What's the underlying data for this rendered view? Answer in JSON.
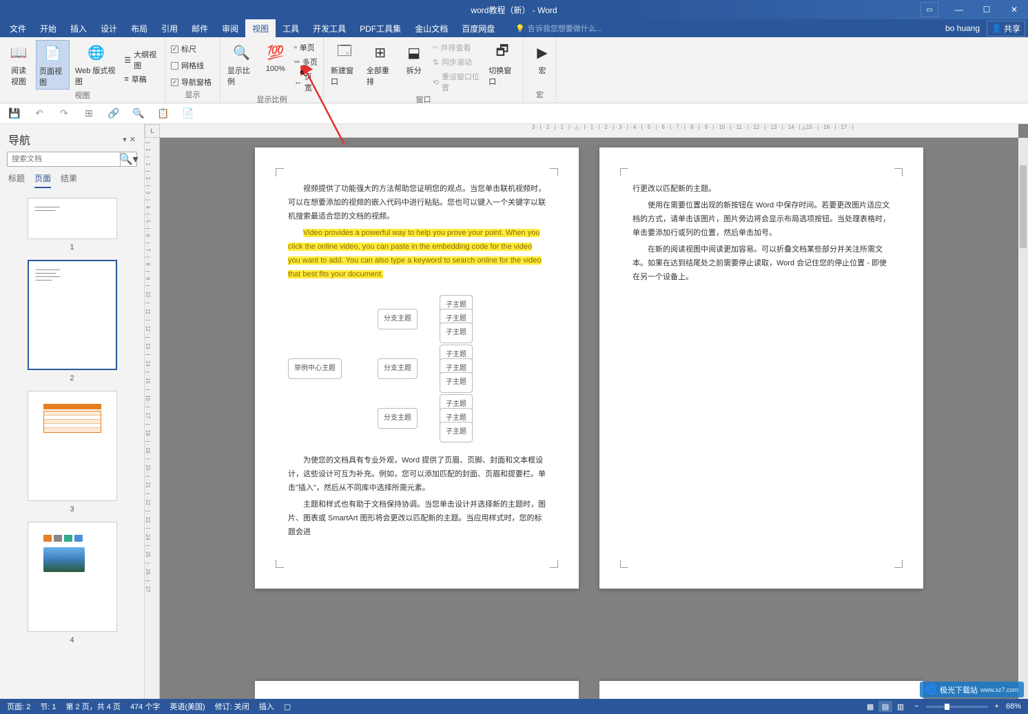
{
  "title": "word教程（新） - Word",
  "username": "bo huang",
  "share": "共享",
  "menu": [
    "文件",
    "开始",
    "插入",
    "设计",
    "布局",
    "引用",
    "邮件",
    "审阅",
    "视图",
    "工具",
    "开发工具",
    "PDF工具集",
    "金山文档",
    "百度网盘"
  ],
  "menu_active": "视图",
  "tellme": "告诉我您想要做什么...",
  "ribbon": {
    "views_group": {
      "read": "阅读\n视图",
      "page": "页面视图",
      "web": "Web 版式视图",
      "outline": "大纲视图",
      "draft": "草稿",
      "label": "视图"
    },
    "show_group": {
      "ruler": "标尺",
      "gridlines": "网格线",
      "navpane": "导航窗格",
      "label": "显示"
    },
    "zoom_group": {
      "showzoom": "显示比例",
      "hundred": "100%",
      "single": "单页",
      "multi": "多页",
      "pagewidth": "页宽",
      "label": "显示比例"
    },
    "window_group": {
      "newwin": "新建窗口",
      "arrange": "全部重排",
      "split": "拆分",
      "sidebyside": "并排查看",
      "syncscroll": "同步滚动",
      "resetpos": "重设窗口位置",
      "switch": "切换窗口",
      "label": "窗口"
    },
    "macro_group": {
      "macro": "宏",
      "label": "宏"
    }
  },
  "nav": {
    "title": "导航",
    "search_ph": "搜索文档",
    "tabs": [
      "标题",
      "页面",
      "结果"
    ],
    "tab_active": "页面",
    "pages": [
      "1",
      "2",
      "3",
      "4"
    ]
  },
  "ruler_h": "3 · | · 2 · | · 1 · | · △ · | · 1 · | · 2 · | · 3 · | · 4 · | · 5 · | · 6 · | · 7 · | · 8 · | · 9 · | · 10 · | · 11 · | · 12 · | · 13 · | · 14 · | △15 · | · 16 · | · 17 · |",
  "ruler_v": "| · 1 · | · 1 · | · 2 · | · 3 · | · 4 · | · 5 · | · 6 · | · 7 · | · 8 · | · 9 · | · 10 · | · 11 · | · 12 · | · 13 · | · 14 · | · 15 · | · 16 · | · 17 · | · 18 · | · 19 · | · 20 · | · 21 · | · 22 · | · 23 · | · 24 · | · 25 · | · 26 · | · 27",
  "ruler_corner": "L",
  "doc": {
    "p2_para1": "视频提供了功能强大的方法帮助您证明您的观点。当您单击联机视频时，可以在想要添加的视频的嵌入代码中进行粘贴。您也可以键入一个关键字以联机搜索最适合您的文档的视频。",
    "p2_hl": "Video provides a powerful way to help you prove your point. When you click the online video, you can paste in the embedding code for the video you want to add. You can also type a keyword to search online for the video that best fits your document.",
    "mm_center": "举例中心主题",
    "mm_branch": "分支主题",
    "mm_sub": "子主题",
    "p2_para2": "为使您的文档具有专业外观，Word 提供了页眉、页脚、封面和文本框设计，这些设计可互为补充。例如，您可以添加匹配的封面、页眉和提要栏。单击\"插入\"，然后从不同库中选择所需元素。",
    "p2_para3": "主题和样式也有助于文档保持协调。当您单击设计并选择新的主题时，图片、图表或 SmartArt 图形将会更改以匹配新的主题。当应用样式时，您的标题会进",
    "p3_para1": "行更改以匹配新的主题。",
    "p3_para2": "使用在需要位置出现的新按钮在 Word 中保存时间。若要更改图片适应文档的方式，请单击该图片，图片旁边将会显示布局选项按钮。当处理表格时，单击要添加行或列的位置，然后单击加号。",
    "p3_para3": "在新的阅读视图中阅读更加容易。可以折叠文档某些部分并关注所需文本。如果在达到结尾处之前需要停止读取，Word 会记住您的停止位置 - 即使在另一个设备上。"
  },
  "status": {
    "page": "页面: 2",
    "section": "节: 1",
    "pages": "第 2 页，共 4 页",
    "words": "474 个字",
    "lang": "英语(美国)",
    "revise": "修订: 关闭",
    "insert": "插入",
    "zoom": "68%"
  },
  "watermark": "极光下载站",
  "watermark_url": "www.xz7.com"
}
